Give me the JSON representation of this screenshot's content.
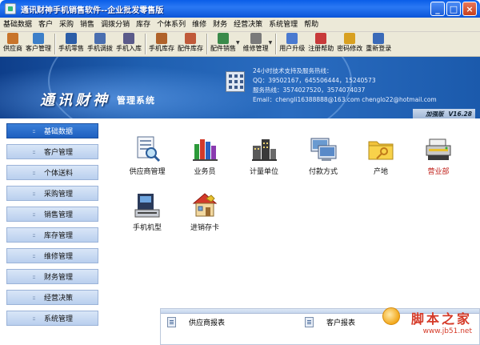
{
  "window": {
    "title": "通讯财神手机销售软件--企业批发零售版",
    "minimize": "_",
    "maximize": "□",
    "close": "×"
  },
  "menu": [
    "基础数据",
    "客户",
    "采购",
    "销售",
    "调拨分销",
    "库存",
    "个体系列",
    "维修",
    "财务",
    "经营决策",
    "系统管理",
    "帮助"
  ],
  "toolbar": [
    {
      "label": "供应商",
      "icon": "supplier-icon",
      "color": "#c8742a"
    },
    {
      "label": "客户管理",
      "icon": "customer-icon",
      "color": "#3c7fc9"
    },
    {
      "label": "手机零售",
      "icon": "phone-retail-icon",
      "color": "#2c5ea8"
    },
    {
      "label": "手机调拨",
      "icon": "phone-transfer-icon",
      "color": "#4a6fb0"
    },
    {
      "label": "手机入库",
      "icon": "phone-stockin-icon",
      "color": "#5a5a8a"
    },
    {
      "label": "手机库存",
      "icon": "phone-stock-icon",
      "color": "#b0622a"
    },
    {
      "label": "配件库存",
      "icon": "parts-stock-icon",
      "color": "#c05a3a"
    },
    {
      "label": "配件销售",
      "icon": "parts-sales-icon",
      "color": "#3a8a4a"
    },
    {
      "label": "维修管理",
      "icon": "repair-icon",
      "color": "#7a7a7a"
    },
    {
      "label": "用户升级",
      "icon": "upgrade-icon",
      "color": "#4a7ad0"
    },
    {
      "label": "注册帮助",
      "icon": "register-help-icon",
      "color": "#c83a3a"
    },
    {
      "label": "密码修改",
      "icon": "password-icon",
      "color": "#d8a020"
    },
    {
      "label": "重新登录",
      "icon": "relogin-icon",
      "color": "#3a6ab8"
    }
  ],
  "banner": {
    "brand": "通讯财神",
    "brand_sub": "管理系统",
    "contact": [
      "24小时技术支持及服务热线：",
      "QQ：39502167，645506444，15240573",
      "服务热线：3574027520，3574074037",
      "Email：chengli16388888@163.com     chenglo22@hotmail.com"
    ],
    "edition": "加强版",
    "version": "V16.28"
  },
  "nav": [
    {
      "label": "基础数据",
      "active": true
    },
    {
      "label": "客户管理",
      "active": false
    },
    {
      "label": "个体送料",
      "active": false
    },
    {
      "label": "采购管理",
      "active": false
    },
    {
      "label": "销售管理",
      "active": false
    },
    {
      "label": "库存管理",
      "active": false
    },
    {
      "label": "维修管理",
      "active": false
    },
    {
      "label": "财务管理",
      "active": false
    },
    {
      "label": "经营决策",
      "active": false
    },
    {
      "label": "系统管理",
      "active": false
    }
  ],
  "functions": [
    {
      "label": "供应商管理",
      "icon": "supplier-manage-icon",
      "red": false
    },
    {
      "label": "业务员",
      "icon": "salesman-icon",
      "red": false
    },
    {
      "label": "计量单位",
      "icon": "unit-icon",
      "red": false
    },
    {
      "label": "付款方式",
      "icon": "payment-method-icon",
      "red": false
    },
    {
      "label": "产地",
      "icon": "origin-icon",
      "red": false
    },
    {
      "label": "营业部",
      "icon": "sales-dept-icon",
      "red": true
    },
    {
      "label": "手机机型",
      "icon": "phone-model-icon",
      "red": false
    },
    {
      "label": "进销存卡",
      "icon": "inventory-card-icon",
      "red": false
    }
  ],
  "panel": {
    "items": [
      "供应商报表",
      "客户报表"
    ]
  },
  "watermark": {
    "line1": "脚本之家",
    "line2": "www.jb51.net"
  }
}
